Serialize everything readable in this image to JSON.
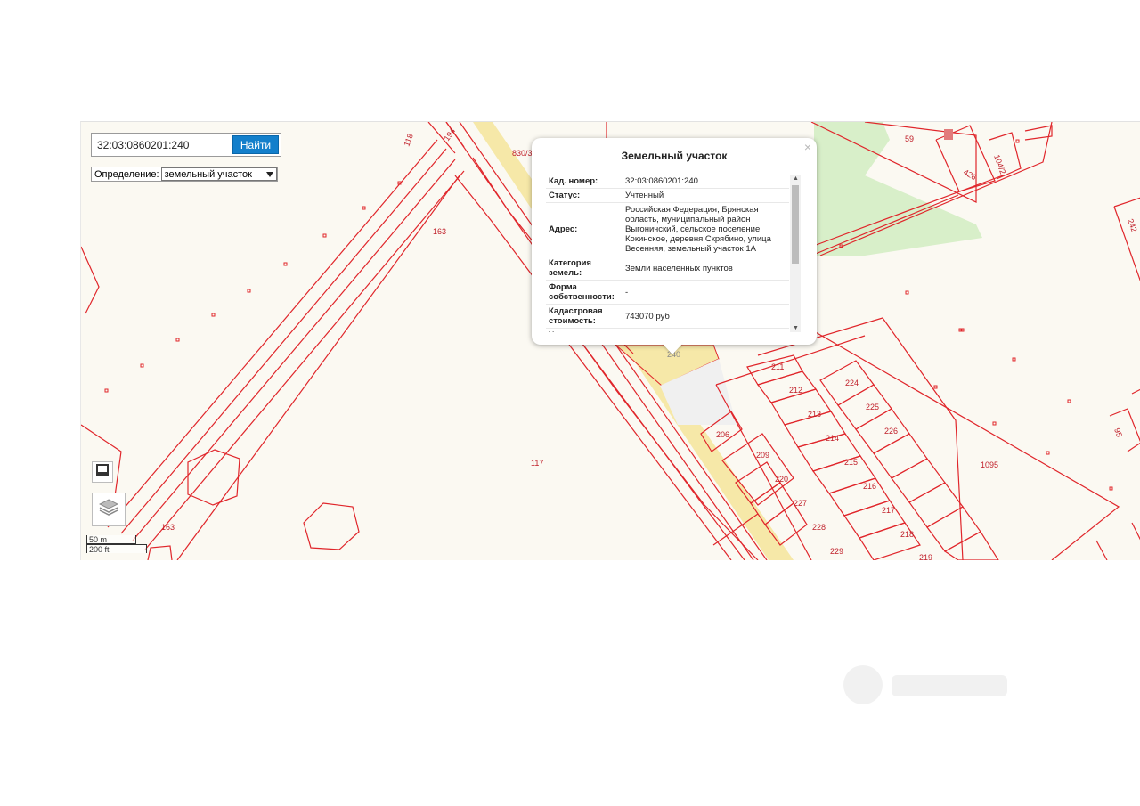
{
  "search": {
    "value": "32:03:0860201:240",
    "button_label": "Найти"
  },
  "definition": {
    "label": "Определение:",
    "selected": "земельный участок"
  },
  "popup": {
    "title": "Земельный участок",
    "close": "×",
    "rows": [
      {
        "key": "Кад. номер:",
        "value": "32:03:0860201:240"
      },
      {
        "key": "Статус:",
        "value": "Учтенный"
      },
      {
        "key": "Адрес:",
        "value": "Российская Федерация, Брянская область, муниципальный район Выгоничский, сельское поселение Кокинское, деревня Скрябино, улица Весенняя, земельный участок 1А"
      },
      {
        "key": "Категория земель:",
        "value": "Земли населенных пунктов"
      },
      {
        "key": "Форма собственности:",
        "value": "-"
      },
      {
        "key": "Кадастровая стоимость:",
        "value": "743070 руб"
      },
      {
        "key": "Уточненная",
        "value": ""
      }
    ]
  },
  "scale": {
    "metric": "50 m",
    "imperial": "200 ft"
  },
  "map_labels": {
    "l118": "118",
    "l194": "194",
    "l830": "830/3",
    "l59": "59",
    "l426": "426",
    "l1042": "104/2",
    "l242": "242",
    "l163a": "163",
    "l163b": "163",
    "l117": "117",
    "l240": "240",
    "l211": "211",
    "l212": "212",
    "l213": "213",
    "l214": "214",
    "l215": "215",
    "l216": "216",
    "l217": "217",
    "l218": "218",
    "l219": "219",
    "l224": "224",
    "l225": "225",
    "l226": "226",
    "l206": "206",
    "l209": "209",
    "l220": "220",
    "l227": "227",
    "l228": "228",
    "l229": "229",
    "l1095": "1095",
    "l95": "95"
  },
  "colors": {
    "boundary": "#e0262b",
    "parcel_fill": "#f6e8a8",
    "green": "#d8efc9",
    "button": "#137fcb"
  },
  "icons": {
    "basemap": "square-icon",
    "layers": "layers-icon",
    "dropdown": "chevron-down-icon"
  }
}
